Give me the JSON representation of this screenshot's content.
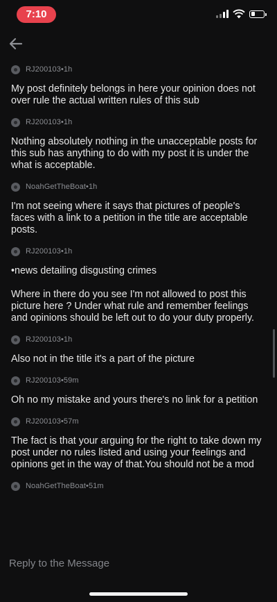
{
  "status_bar": {
    "time": "7:10"
  },
  "messages": [
    {
      "author": "RJ200103",
      "age": "1h",
      "text": "My post definitely belongs in here your opinion does not over rule the actual written rules of this sub"
    },
    {
      "author": "RJ200103",
      "age": "1h",
      "text": "Nothing absolutely nothing in the unacceptable posts for this sub has anything to do with my post it is under the what is acceptable."
    },
    {
      "author": "NoahGetTheBoat",
      "age": "1h",
      "text": "I'm not seeing where it says that pictures of people's faces with a link to a petition in the title are acceptable posts."
    },
    {
      "author": "RJ200103",
      "age": "1h",
      "text": "•news detailing disgusting crimes\n\nWhere in there do you see I'm not allowed to post this picture here ? Under what rule and remember feelings and opinions should be left out to do your duty properly."
    },
    {
      "author": "RJ200103",
      "age": "1h",
      "text": "Also not in the title it's a part of the picture"
    },
    {
      "author": "RJ200103",
      "age": "59m",
      "text": "Oh no my mistake and yours there's no link for a petition"
    },
    {
      "author": "RJ200103",
      "age": "57m",
      "text": "The fact is that your arguing for the right to take down my post under no rules listed and using your feelings and opinions get in the way of that.You should not be a mod"
    },
    {
      "author": "NoahGetTheBoat",
      "age": "51m",
      "text": ""
    }
  ],
  "reply": {
    "placeholder": "Reply to the Message"
  },
  "separator": " • "
}
